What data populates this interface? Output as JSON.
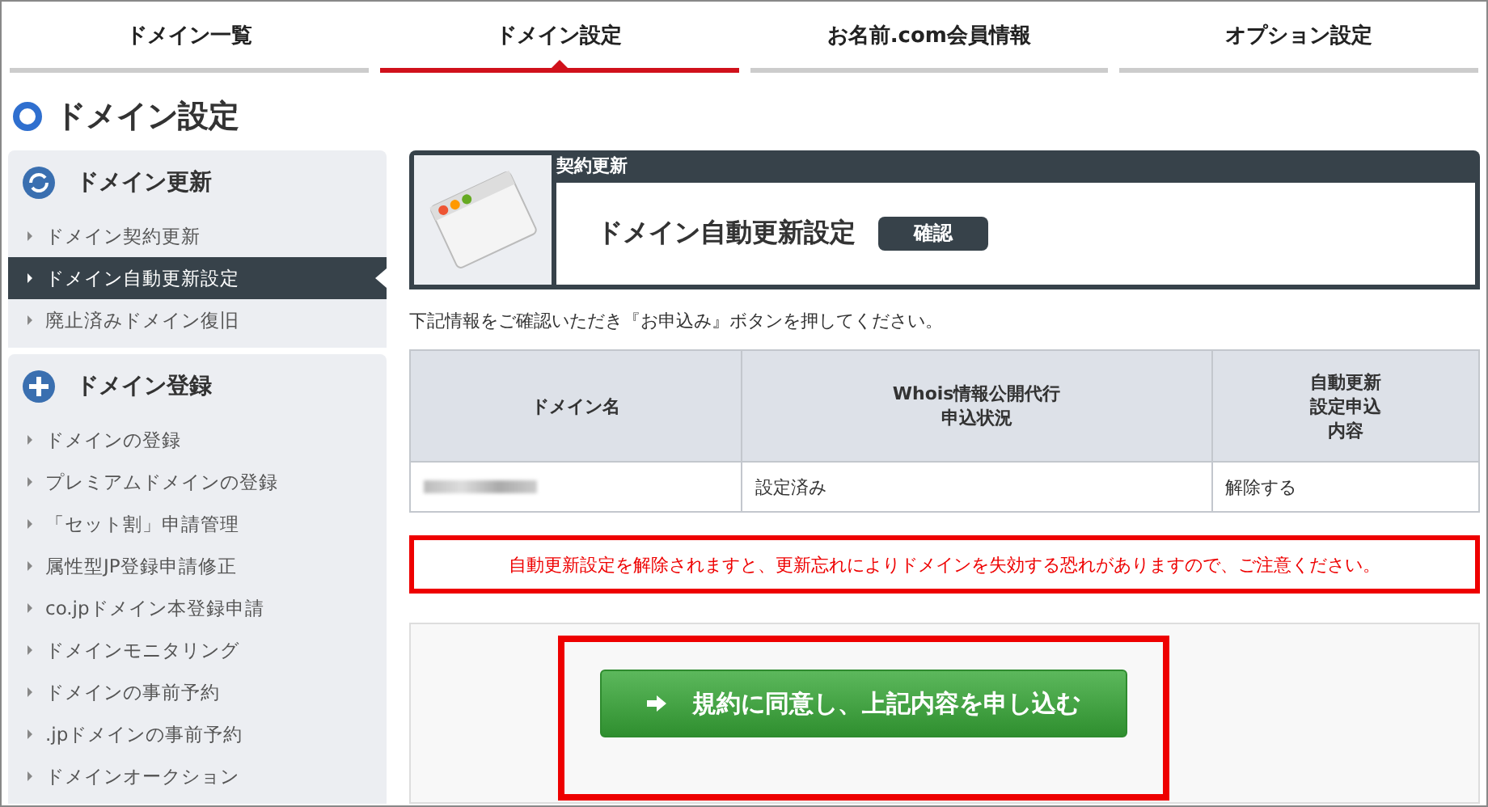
{
  "tabs": [
    {
      "label": "ドメイン一覧",
      "selected": false
    },
    {
      "label": "ドメイン設定",
      "selected": true
    },
    {
      "label": "お名前.com会員情報",
      "selected": false
    },
    {
      "label": "オプション設定",
      "selected": false
    }
  ],
  "page_title": "ドメイン設定",
  "sidebar": [
    {
      "title": "ドメイン更新",
      "kind": "refresh",
      "items": [
        {
          "label": "ドメイン契約更新",
          "selected": false
        },
        {
          "label": "ドメイン自動更新設定",
          "selected": true
        },
        {
          "label": "廃止済みドメイン復旧",
          "selected": false
        }
      ]
    },
    {
      "title": "ドメイン登録",
      "kind": "plus",
      "items": [
        {
          "label": "ドメインの登録",
          "selected": false
        },
        {
          "label": "プレミアムドメインの登録",
          "selected": false
        },
        {
          "label": "「セット割」申請管理",
          "selected": false
        },
        {
          "label": "属性型JP登録申請修正",
          "selected": false
        },
        {
          "label": "co.jpドメイン本登録申請",
          "selected": false
        },
        {
          "label": "ドメインモニタリング",
          "selected": false
        },
        {
          "label": "ドメインの事前予約",
          "selected": false
        },
        {
          "label": ".jpドメインの事前予約",
          "selected": false
        },
        {
          "label": "ドメインオークション",
          "selected": false
        }
      ]
    }
  ],
  "header": {
    "category": "契約更新",
    "title": "ドメイン自動更新設定",
    "badge": "確認"
  },
  "instruction": "下記情報をご確認いただき『お申込み』ボタンを押してください。",
  "table": {
    "columns": [
      "ドメイン名",
      "Whois情報公開代行申込状況",
      "自動更新設定申込内容"
    ],
    "rows": [
      [
        {
          "kind": "blurred"
        },
        {
          "kind": "text",
          "text": "設定済み"
        },
        {
          "kind": "text",
          "text": "解除する"
        }
      ]
    ]
  },
  "warning": "自動更新設定を解除されますと、更新忘れによりドメインを失効する恐れがありますので、ご注意ください。",
  "submit_button": "規約に同意し、上記内容を申し込む"
}
